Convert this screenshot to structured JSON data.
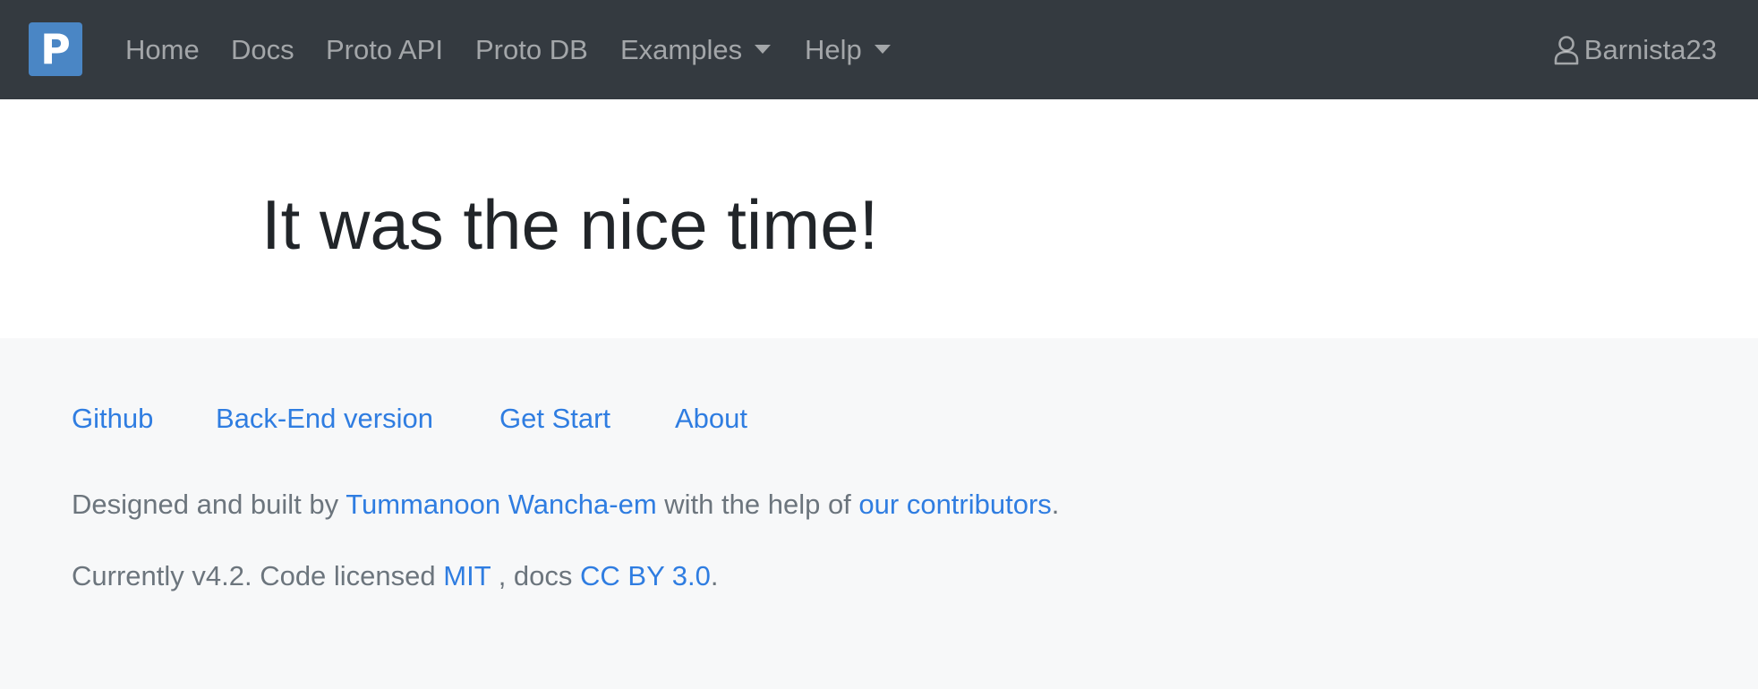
{
  "navbar": {
    "brand_letter": "P",
    "items": [
      {
        "label": "Home"
      },
      {
        "label": "Docs"
      },
      {
        "label": "Proto API"
      },
      {
        "label": "Proto DB"
      },
      {
        "label": "Examples",
        "dropdown": true
      },
      {
        "label": "Help",
        "dropdown": true
      }
    ],
    "user_name": "Barnista23",
    "user_icon": "person-icon"
  },
  "hero": {
    "title": "It was the nice time!"
  },
  "footer": {
    "links": [
      {
        "label": "Github"
      },
      {
        "label": "Back-End version"
      },
      {
        "label": "Get Start"
      },
      {
        "label": "About"
      }
    ],
    "credit": {
      "prefix": "Designed and built by ",
      "author": "Tummanoon Wancha-em",
      "middle": " with the help of ",
      "contributors": "our contributors",
      "suffix": "."
    },
    "license": {
      "prefix": "Currently v4.2. Code licensed ",
      "code_license": "MIT",
      "middle": " , docs ",
      "docs_license": "CC BY 3.0",
      "suffix": "."
    }
  },
  "colors": {
    "navbar_bg": "#343a40",
    "brand_bg": "#4a86c5",
    "link": "#2f7de1",
    "muted_text": "#6c757d",
    "footer_bg": "#f7f8f9"
  }
}
